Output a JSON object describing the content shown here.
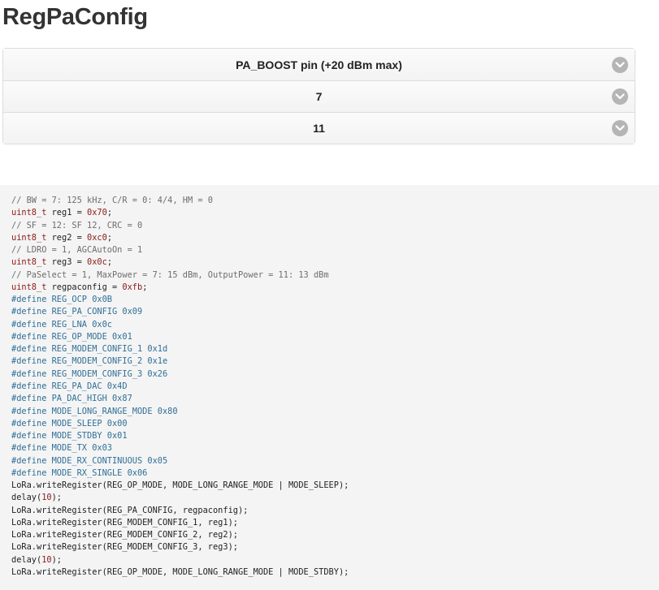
{
  "page_title": "RegPaConfig",
  "selects": [
    {
      "value": "PA_BOOST pin (+20 dBm max)"
    },
    {
      "value": "7"
    },
    {
      "value": "11"
    }
  ],
  "code_lines": [
    [
      {
        "t": "// BW = 7: 125 kHz, C/R = 0: 4/4, HM = 0",
        "c": "comment"
      }
    ],
    [
      {
        "t": "uint8_t",
        "c": "type"
      },
      {
        "t": " reg1 = ",
        "c": "plain"
      },
      {
        "t": "0x70",
        "c": "num"
      },
      {
        "t": ";",
        "c": "plain"
      }
    ],
    [
      {
        "t": "// SF = 12: SF 12, CRC = 0",
        "c": "comment"
      }
    ],
    [
      {
        "t": "uint8_t",
        "c": "type"
      },
      {
        "t": " reg2 = ",
        "c": "plain"
      },
      {
        "t": "0xc0",
        "c": "num"
      },
      {
        "t": ";",
        "c": "plain"
      }
    ],
    [
      {
        "t": "// LDRO = 1, AGCAutoOn = 1",
        "c": "comment"
      }
    ],
    [
      {
        "t": "uint8_t",
        "c": "type"
      },
      {
        "t": " reg3 = ",
        "c": "plain"
      },
      {
        "t": "0x0c",
        "c": "num"
      },
      {
        "t": ";",
        "c": "plain"
      }
    ],
    [
      {
        "t": "// PaSelect = 1, MaxPower = 7: 15 dBm, OutputPower = 11: 13 dBm",
        "c": "comment"
      }
    ],
    [
      {
        "t": "uint8_t",
        "c": "type"
      },
      {
        "t": " regpaconfig = ",
        "c": "plain"
      },
      {
        "t": "0xfb",
        "c": "num"
      },
      {
        "t": ";",
        "c": "plain"
      }
    ],
    [
      {
        "t": "#define REG_OCP 0x0B",
        "c": "define"
      }
    ],
    [
      {
        "t": "#define REG_PA_CONFIG 0x09",
        "c": "define"
      }
    ],
    [
      {
        "t": "#define REG_LNA 0x0c",
        "c": "define"
      }
    ],
    [
      {
        "t": "#define REG_OP_MODE 0x01",
        "c": "define"
      }
    ],
    [
      {
        "t": "#define REG_MODEM_CONFIG_1 0x1d",
        "c": "define"
      }
    ],
    [
      {
        "t": "#define REG_MODEM_CONFIG_2 0x1e",
        "c": "define"
      }
    ],
    [
      {
        "t": "#define REG_MODEM_CONFIG_3 0x26",
        "c": "define"
      }
    ],
    [
      {
        "t": "#define REG_PA_DAC 0x4D",
        "c": "define"
      }
    ],
    [
      {
        "t": "#define PA_DAC_HIGH 0x87",
        "c": "define"
      }
    ],
    [
      {
        "t": "#define MODE_LONG_RANGE_MODE 0x80",
        "c": "define"
      }
    ],
    [
      {
        "t": "#define MODE_SLEEP 0x00",
        "c": "define"
      }
    ],
    [
      {
        "t": "#define MODE_STDBY 0x01",
        "c": "define"
      }
    ],
    [
      {
        "t": "#define MODE_TX 0x03",
        "c": "define"
      }
    ],
    [
      {
        "t": "#define MODE_RX_CONTINUOUS 0x05",
        "c": "define"
      }
    ],
    [
      {
        "t": "#define MODE_RX_SINGLE 0x06",
        "c": "define"
      }
    ],
    [
      {
        "t": "LoRa.writeRegister(REG_OP_MODE, MODE_LONG_RANGE_MODE | MODE_SLEEP);",
        "c": "plain"
      }
    ],
    [
      {
        "t": "delay(",
        "c": "plain"
      },
      {
        "t": "10",
        "c": "num"
      },
      {
        "t": ");",
        "c": "plain"
      }
    ],
    [
      {
        "t": "LoRa.writeRegister(REG_PA_CONFIG, regpaconfig);",
        "c": "plain"
      }
    ],
    [
      {
        "t": "LoRa.writeRegister(REG_MODEM_CONFIG_1, reg1);",
        "c": "plain"
      }
    ],
    [
      {
        "t": "LoRa.writeRegister(REG_MODEM_CONFIG_2, reg2);",
        "c": "plain"
      }
    ],
    [
      {
        "t": "LoRa.writeRegister(REG_MODEM_CONFIG_3, reg3);",
        "c": "plain"
      }
    ],
    [
      {
        "t": "delay(",
        "c": "plain"
      },
      {
        "t": "10",
        "c": "num"
      },
      {
        "t": ");",
        "c": "plain"
      }
    ],
    [
      {
        "t": "LoRa.writeRegister(REG_OP_MODE, MODE_LONG_RANGE_MODE | MODE_STDBY);",
        "c": "plain"
      }
    ]
  ],
  "colors": {
    "comment": "#6d6d6d",
    "type": "#8b1a1a",
    "number": "#8b1a1a",
    "define": "#2f6f97",
    "code_background": "#f4f4f4"
  },
  "icons": {
    "select_toggle": "chevron-down-icon"
  }
}
